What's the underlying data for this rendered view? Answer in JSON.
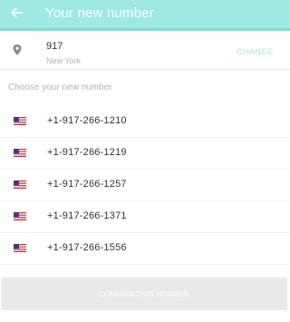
{
  "header": {
    "title": "Your new number",
    "back_icon": "arrow-left-icon"
  },
  "area": {
    "code": "917",
    "city": "New York",
    "change_label": "CHANGE",
    "icon": "location-pin-icon"
  },
  "section_label": "Choose your new number",
  "numbers": [
    {
      "flag": "us-flag-icon",
      "number": "+1-917-266-1210"
    },
    {
      "flag": "us-flag-icon",
      "number": "+1-917-266-1219"
    },
    {
      "flag": "us-flag-icon",
      "number": "+1-917-266-1257"
    },
    {
      "flag": "us-flag-icon",
      "number": "+1-917-266-1371"
    },
    {
      "flag": "us-flag-icon",
      "number": "+1-917-266-1556"
    }
  ],
  "confirm_label": "CONFIRM THIS NUMBER",
  "colors": {
    "appbar": "#9ee9e1",
    "accent": "#a7e6df",
    "confirm_disabled": "#e9e9e9"
  }
}
